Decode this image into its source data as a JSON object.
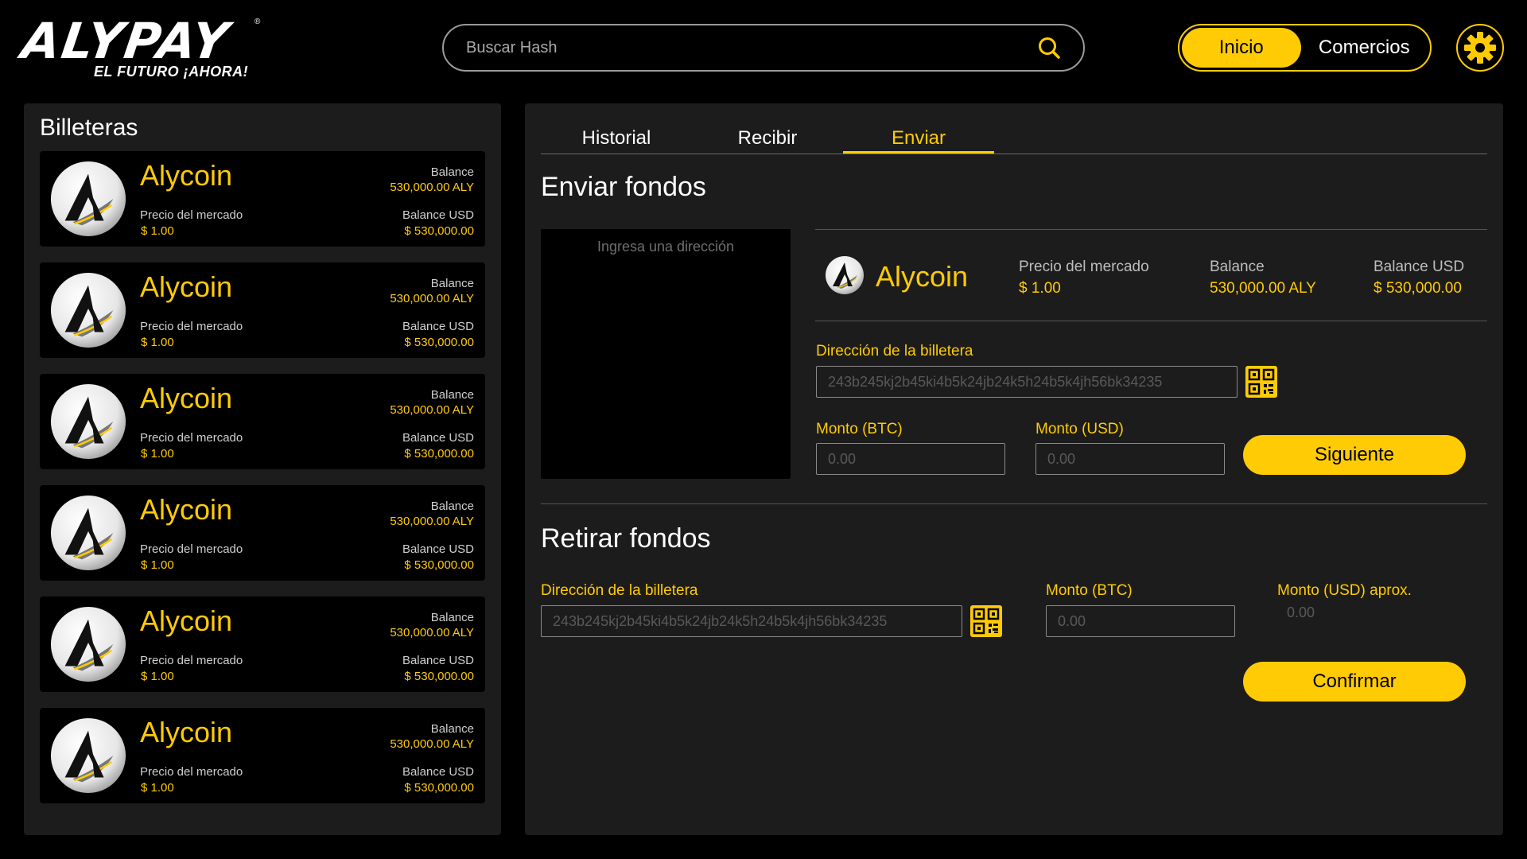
{
  "brand": {
    "name": "ALYPAY",
    "tagline": "EL FUTURO ¡AHORA!",
    "reg": "®"
  },
  "search": {
    "placeholder": "Buscar Hash"
  },
  "nav": {
    "home": "Inicio",
    "merchants": "Comercios"
  },
  "colors": {
    "accent": "#ffcb05",
    "panel": "#1c1c1c",
    "background": "#000000"
  },
  "wallets": {
    "title": "Billeteras",
    "items": [
      {
        "name": "Alycoin",
        "market_label": "Precio del mercado",
        "market_value": "$ 1.00",
        "balance_label": "Balance",
        "balance_value": "530,000.00 ALY",
        "usd_label": "Balance USD",
        "usd_value": "$ 530,000.00"
      },
      {
        "name": "Alycoin",
        "market_label": "Precio del mercado",
        "market_value": "$ 1.00",
        "balance_label": "Balance",
        "balance_value": "530,000.00 ALY",
        "usd_label": "Balance USD",
        "usd_value": "$ 530,000.00"
      },
      {
        "name": "Alycoin",
        "market_label": "Precio del mercado",
        "market_value": "$ 1.00",
        "balance_label": "Balance",
        "balance_value": "530,000.00 ALY",
        "usd_label": "Balance USD",
        "usd_value": "$ 530,000.00"
      },
      {
        "name": "Alycoin",
        "market_label": "Precio del mercado",
        "market_value": "$ 1.00",
        "balance_label": "Balance",
        "balance_value": "530,000.00 ALY",
        "usd_label": "Balance USD",
        "usd_value": "$ 530,000.00"
      },
      {
        "name": "Alycoin",
        "market_label": "Precio del mercado",
        "market_value": "$ 1.00",
        "balance_label": "Balance",
        "balance_value": "530,000.00 ALY",
        "usd_label": "Balance USD",
        "usd_value": "$ 530,000.00"
      },
      {
        "name": "Alycoin",
        "market_label": "Precio del mercado",
        "market_value": "$ 1.00",
        "balance_label": "Balance",
        "balance_value": "530,000.00 ALY",
        "usd_label": "Balance USD",
        "usd_value": "$ 530,000.00"
      }
    ]
  },
  "tabs": {
    "history": "Historial",
    "receive": "Recibir",
    "send": "Enviar",
    "active": "send"
  },
  "send": {
    "title": "Enviar fondos",
    "qr_placeholder": "Ingresa una dirección",
    "coin": {
      "name": "Alycoin",
      "market_label": "Precio del mercado",
      "market_value": "$ 1.00",
      "balance_label": "Balance",
      "balance_value": "530,000.00 ALY",
      "usd_label": "Balance USD",
      "usd_value": "$ 530,000.00"
    },
    "address_label": "Dirección de la billetera",
    "address_placeholder": "243b245kj2b45ki4b5k24jb24k5h24b5k4jh56bk34235",
    "btc_label": "Monto (BTC)",
    "btc_placeholder": "0.00",
    "usd_label": "Monto (USD)",
    "usd_placeholder": "0.00",
    "next_button": "Siguiente"
  },
  "withdraw": {
    "title": "Retirar fondos",
    "address_label": "Dirección de la billetera",
    "address_placeholder": "243b245kj2b45ki4b5k24jb24k5h24b5k4jh56bk34235",
    "btc_label": "Monto (BTC)",
    "btc_placeholder": "0.00",
    "usd_label": "Monto (USD) aprox.",
    "usd_value": "0.00",
    "confirm_button": "Confirmar"
  },
  "icons": {
    "search": "search-icon",
    "settings": "gear-icon",
    "qr": "qr-code-icon",
    "coin": "alycoin-logo-icon"
  }
}
